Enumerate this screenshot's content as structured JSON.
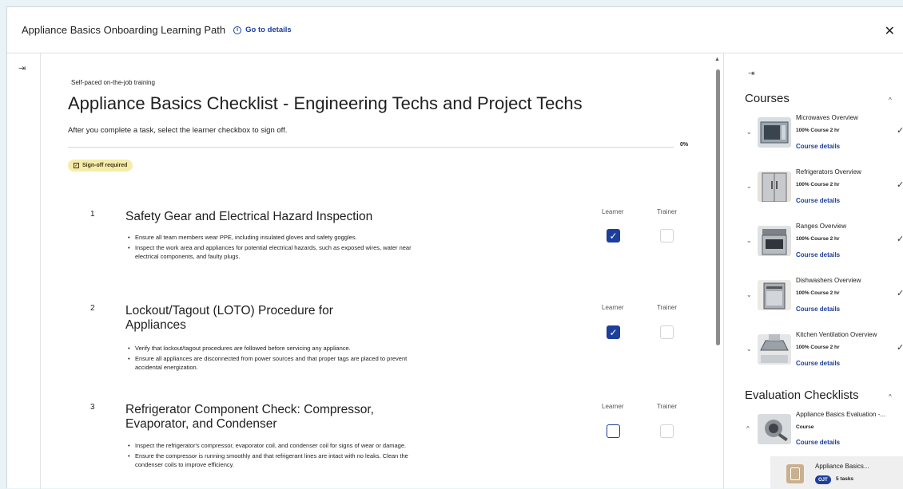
{
  "header": {
    "title": "Appliance Basics Onboarding Learning Path",
    "go_to_details": "Go to details",
    "info_icon_glyph": "i",
    "close_glyph": "✕"
  },
  "left_strip": {
    "collapse_glyph": "⇥"
  },
  "main": {
    "eyebrow": "Self-paced on-the-job training",
    "title": "Appliance Basics Checklist - Engineering Techs and Project Techs",
    "instruction": "After you complete a task, select the learner checkbox to sign off.",
    "progress_percent": 0,
    "progress_label": "0%",
    "badge": "Sign-off required",
    "learner_label": "Learner",
    "trainer_label": "Trainer",
    "tasks": [
      {
        "number": "1",
        "title": "Safety Gear and Electrical Hazard Inspection",
        "bullets": [
          "Ensure all team members wear PPE, including insulated gloves and safety goggles.",
          "Inspect the work area and appliances for potential electrical hazards, such as exposed wires, water near electrical components, and faulty plugs."
        ],
        "learner_checked": true,
        "trainer_checked": false
      },
      {
        "number": "2",
        "title": "Lockout/Tagout (LOTO) Procedure for Appliances",
        "bullets": [
          "Verify that lockout/tagout procedures are followed before servicing any appliance.",
          "Ensure all appliances are disconnected from power sources and that proper tags are placed to prevent accidental energization."
        ],
        "learner_checked": true,
        "trainer_checked": false
      },
      {
        "number": "3",
        "title": "Refrigerator Component Check: Compressor, Evaporator, and Condenser",
        "bullets": [
          "Inspect the refrigerator's compressor, evaporator coil, and condenser coil for signs of wear or damage.",
          "Ensure the compressor is running smoothly and that refrigerant lines are intact with no leaks. Clean the condenser coils to improve efficiency."
        ],
        "learner_checked": false,
        "trainer_checked": false
      }
    ]
  },
  "sidepanel": {
    "collapse_glyph": "⇥",
    "courses_heading": "Courses",
    "eval_heading": "Evaluation Checklists",
    "chevron_up": "^",
    "courses": [
      {
        "name": "Microwaves Overview",
        "meta": "100%  Course  2 hr",
        "details": "Course details",
        "completed": true
      },
      {
        "name": "Refrigerators Overview",
        "meta": "100%  Course  2 hr",
        "details": "Course details",
        "completed": true
      },
      {
        "name": "Ranges Overview",
        "meta": "100%  Course  2 hr",
        "details": "Course details",
        "completed": true
      },
      {
        "name": "Dishwashers Overview",
        "meta": "100%  Course  2 hr",
        "details": "Course details",
        "completed": true
      },
      {
        "name": "Kitchen Ventilation Overview",
        "meta": "100%  Course  2 hr",
        "details": "Course details",
        "completed": true
      }
    ],
    "evaluation": {
      "name": "Appliance Basics Evaluation -...",
      "meta": "Course",
      "details": "Course details",
      "sub_item": {
        "name": "Appliance Basics...",
        "pill": "OJT",
        "tasks": "5 tasks"
      }
    }
  },
  "colors": {
    "accent": "#1d3f9c",
    "badge_bg": "#f6ecaa",
    "page_bg": "#e9f3f7"
  }
}
